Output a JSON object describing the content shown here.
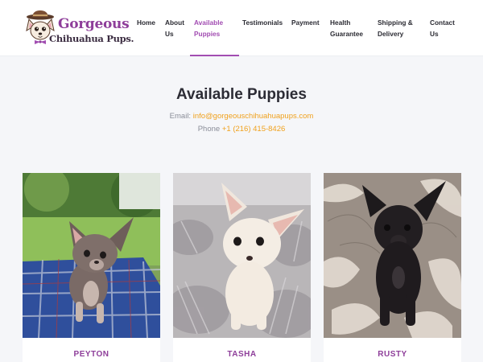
{
  "brand": {
    "line1": "Gorgeous",
    "line2": "Chihuahua Pups."
  },
  "nav": {
    "home": "Home",
    "about_1": "About",
    "about_2": "Us",
    "available_1": "Available",
    "available_2": "Puppies",
    "testimonials": "Testimonials",
    "payment": "Payment",
    "health_1": "Health",
    "health_2": "Guarantee",
    "shipping_1": "Shipping &",
    "shipping_2": "Delivery",
    "contact_1": "Contact",
    "contact_2": "Us"
  },
  "main": {
    "title": "Available Puppies",
    "email_label": "Email: ",
    "email_value": "info@gorgeouschihuahuapups.com",
    "phone_label": "Phone ",
    "phone_value": "+1 (216) 415-8426"
  },
  "puppies": [
    {
      "name": "PEYTON",
      "image": "puppy-photo"
    },
    {
      "name": "TASHA",
      "image": "puppy-photo"
    },
    {
      "name": "RUSTY",
      "image": "puppy-photo"
    }
  ],
  "colors": {
    "accent": "#a24db2",
    "brand_purple": "#8e3e9a",
    "link_orange": "#f0a11d",
    "background": "#f5f6f9"
  }
}
